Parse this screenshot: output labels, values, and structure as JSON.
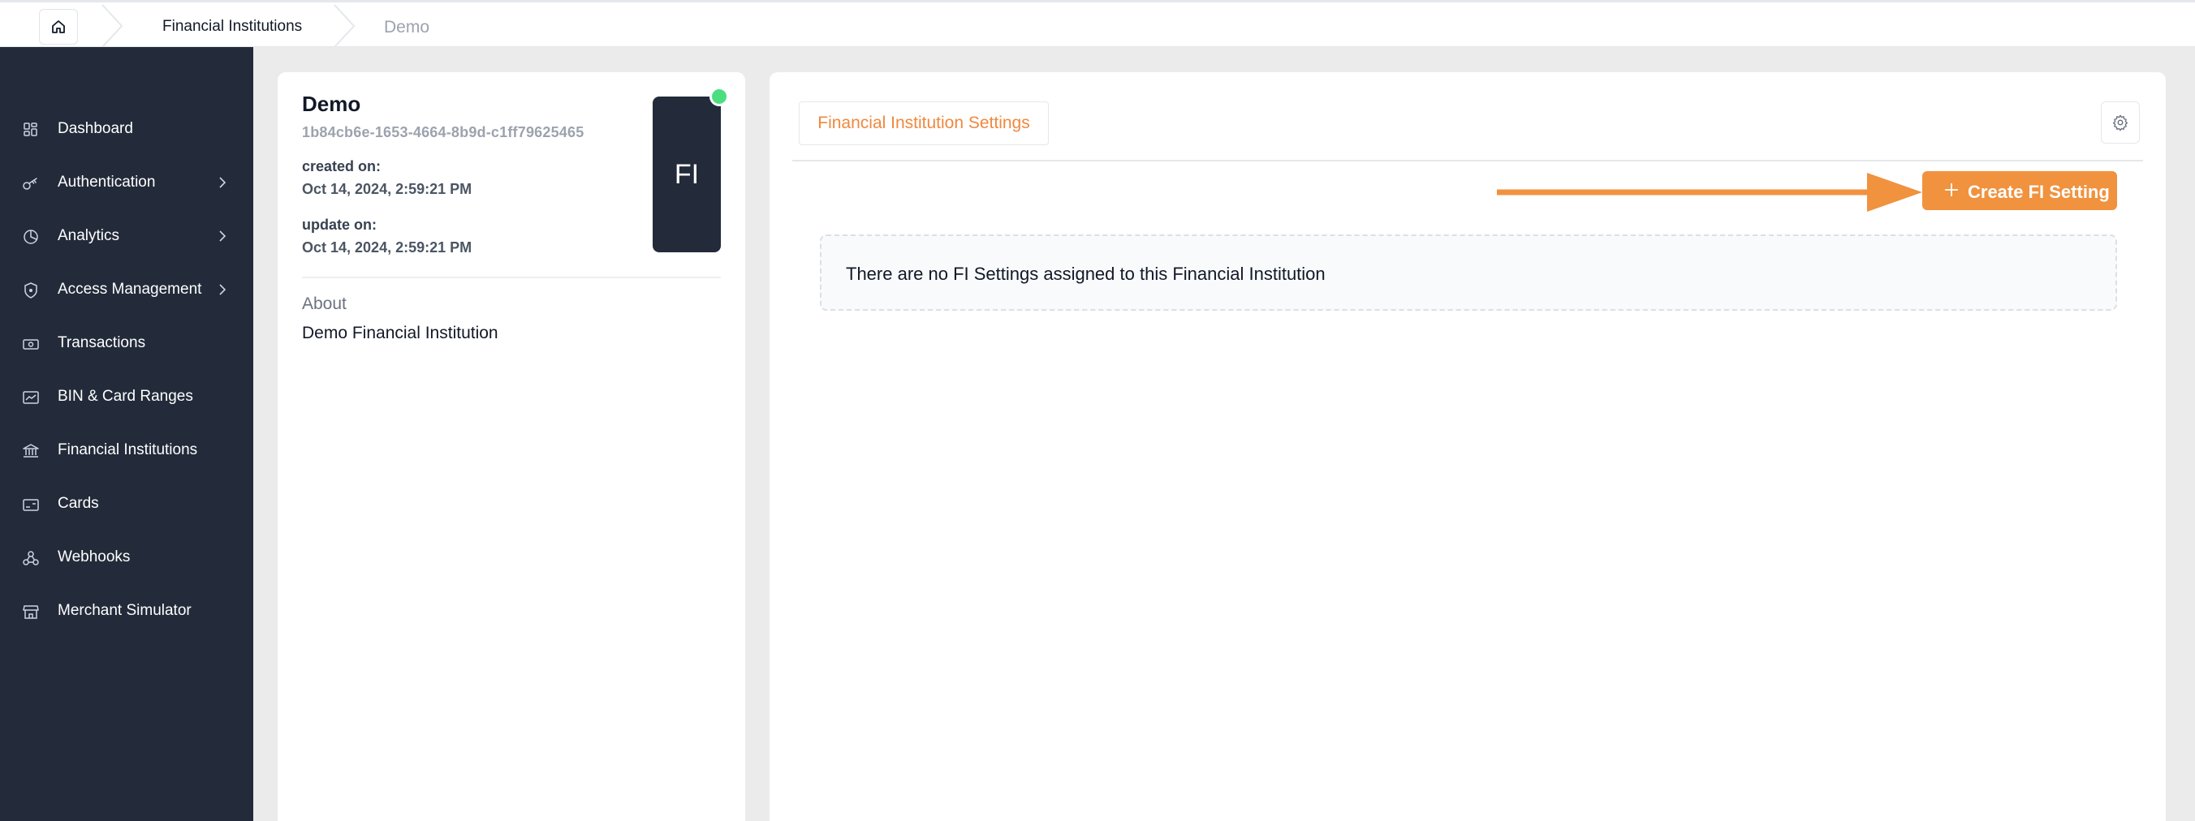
{
  "breadcrumb": {
    "items": [
      "Financial Institutions",
      "Demo"
    ]
  },
  "sidebar": {
    "items": [
      {
        "label": "Dashboard",
        "icon": "dashboard-icon",
        "has_children": false
      },
      {
        "label": "Authentication",
        "icon": "key-icon",
        "has_children": true
      },
      {
        "label": "Analytics",
        "icon": "pie-chart-icon",
        "has_children": true
      },
      {
        "label": "Access Management",
        "icon": "shield-icon",
        "has_children": true
      },
      {
        "label": "Transactions",
        "icon": "banknote-icon",
        "has_children": false
      },
      {
        "label": "BIN & Card Ranges",
        "icon": "card-chart-icon",
        "has_children": false
      },
      {
        "label": "Financial Institutions",
        "icon": "bank-icon",
        "has_children": false
      },
      {
        "label": "Cards",
        "icon": "card-icon",
        "has_children": false
      },
      {
        "label": "Webhooks",
        "icon": "webhook-icon",
        "has_children": false
      },
      {
        "label": "Merchant Simulator",
        "icon": "store-icon",
        "has_children": false
      }
    ]
  },
  "institution": {
    "name": "Demo",
    "id": "1b84cb6e-1653-4664-8b9d-c1ff79625465",
    "created_label": "created on:",
    "created_value": "Oct 14, 2024, 2:59:21 PM",
    "updated_label": "update on:",
    "updated_value": "Oct 14, 2024, 2:59:21 PM",
    "avatar_text": "FI",
    "status_color": "#4ade80",
    "about_label": "About",
    "about_value": "Demo Financial Institution"
  },
  "settings": {
    "tab_label": "Financial Institution Settings",
    "create_button_label": "Create FI Setting",
    "empty_message": "There are no FI Settings assigned to this Financial Institution"
  },
  "colors": {
    "sidebar_bg": "#232b3a",
    "accent": "#f0923e",
    "page_bg": "#ebebeb"
  }
}
